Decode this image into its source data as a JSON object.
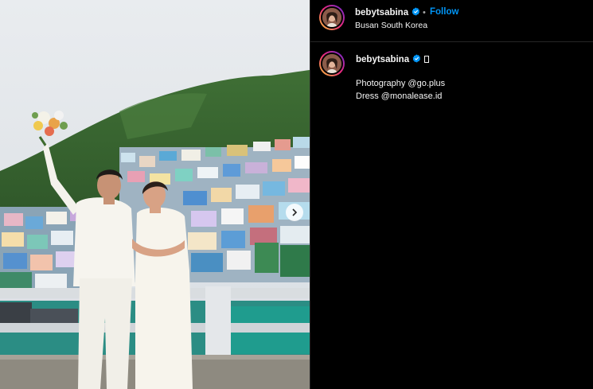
{
  "post": {
    "username": "bebytsabina",
    "location": "Busan South Korea",
    "follow_label": "Follow",
    "separator": "•"
  },
  "caption": {
    "username": "bebytsabina",
    "line1": "Photography @go.plus",
    "line2": "Dress @monalease.id"
  },
  "icons": {
    "verified": "verified-badge-icon",
    "next": "chevron-right-icon",
    "emoji_placeholder": "missing-glyph-icon"
  },
  "colors": {
    "follow": "#0095f6",
    "verified": "#0095f6",
    "background": "#000000"
  }
}
